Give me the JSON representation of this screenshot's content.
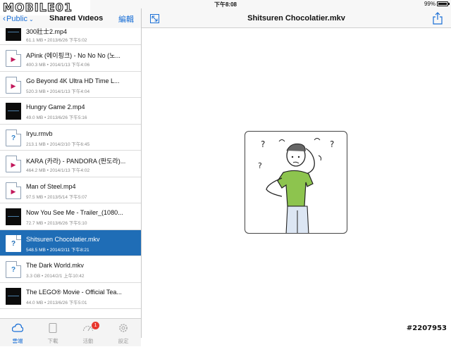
{
  "status_bar": {
    "time": "下午8:08",
    "battery": "99%"
  },
  "watermark_logo": "MOBILE01",
  "left_nav": {
    "back_label": "Public",
    "title": "Shared Videos",
    "edit_label": "編輯"
  },
  "files": [
    {
      "name": "300壯士2.mp4",
      "meta": "61.1 MB • 2013/6/26 下午5:02",
      "thumb": "dark"
    },
    {
      "name": "APink (에이핑크) - No No No (노...",
      "meta": "400.3 MB • 2014/1/13 下午4:06",
      "thumb": "video"
    },
    {
      "name": "Go Beyond  4K Ultra HD Time L...",
      "meta": "520.3 MB • 2014/1/13 下午4:04",
      "thumb": "video"
    },
    {
      "name": "Hungry Game 2.mp4",
      "meta": "49.0 MB • 2013/6/26 下午5:16",
      "thumb": "dark"
    },
    {
      "name": "Iryu.rmvb",
      "meta": "213.1 MB • 2014/2/10 下午6:45",
      "thumb": "unknown"
    },
    {
      "name": "KARA (카라) - PANDORA (판도라)...",
      "meta": "464.2 MB • 2014/1/13 下午4:02",
      "thumb": "video"
    },
    {
      "name": "Man of Steel.mp4",
      "meta": "97.5 MB • 2013/5/14 下午5:07",
      "thumb": "video"
    },
    {
      "name": "Now You See Me - Trailer_(1080...",
      "meta": "72.7 MB • 2013/6/26 下午5:10",
      "thumb": "dark"
    },
    {
      "name": "Shitsuren Chocolatier.mkv",
      "meta": "548.5 MB • 2014/2/11 下午8:21",
      "thumb": "unknown",
      "selected": true
    },
    {
      "name": "The Dark World.mkv",
      "meta": "3.3 GB • 2014/2/1 上午10:42",
      "thumb": "unknown"
    },
    {
      "name": "The LEGO® Movie - Official Tea...",
      "meta": "44.0 MB • 2013/6/26 下午5:01",
      "thumb": "dark"
    }
  ],
  "tabs": [
    {
      "label": "雲端",
      "icon": "cloud-icon",
      "active": true
    },
    {
      "label": "下載",
      "icon": "tablet-icon"
    },
    {
      "label": "活動",
      "icon": "gauge-icon",
      "badge": "1"
    },
    {
      "label": "設定",
      "icon": "gear-icon"
    }
  ],
  "right_nav": {
    "title": "Shitsuren Chocolatier.mkv"
  },
  "preview": {
    "icon": "confused-person-icon"
  },
  "watermark_id": "#2207953",
  "colors": {
    "accent": "#1a6fd6",
    "selected_row": "#1f6db6",
    "badge": "#e8372e",
    "video_icon": "#c2185b"
  }
}
